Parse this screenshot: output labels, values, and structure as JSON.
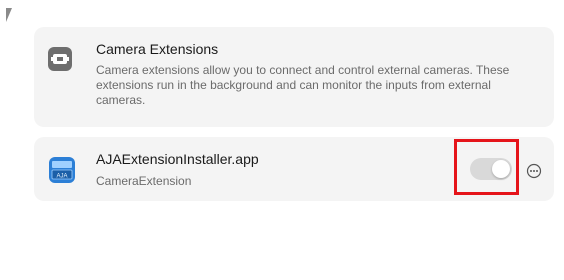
{
  "extensions_info": {
    "icon": "camera-extension-icon",
    "title": "Camera Extensions",
    "description": "Camera extensions allow you to connect and control external cameras. These extensions run in the background and can monitor the inputs from external cameras."
  },
  "app_item": {
    "icon": "aja-app-icon",
    "name": "AJAExtensionInstaller.app",
    "subtitle": "CameraExtension",
    "toggle_enabled": true,
    "more_icon": "ellipsis-circle-icon"
  },
  "colors": {
    "highlight": "#e5141a",
    "card_background": "#f4f4f4"
  }
}
